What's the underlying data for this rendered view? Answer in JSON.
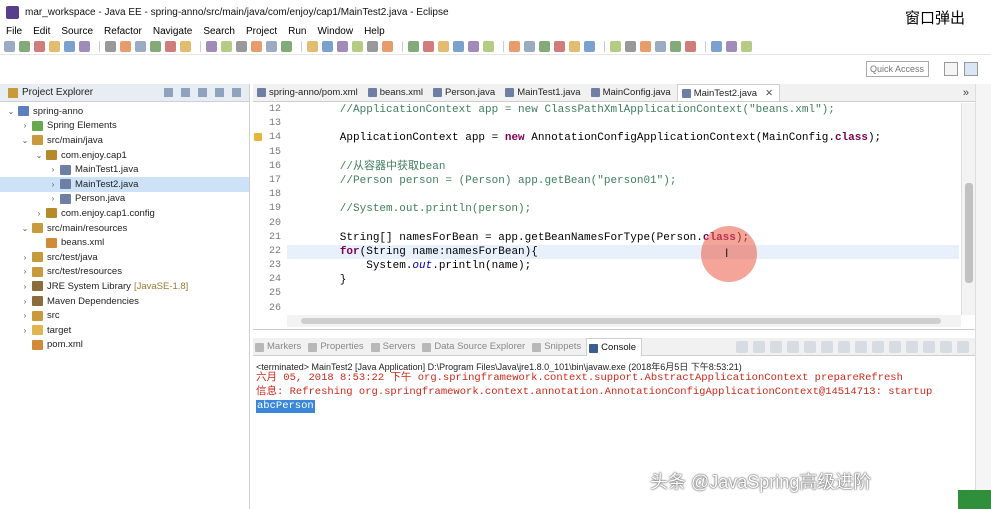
{
  "window": {
    "title": "mar_workspace - Java EE - spring-anno/src/main/java/com/enjoy/cap1/MainTest2.java - Eclipse",
    "popup_label": "窗口弹出"
  },
  "menu": [
    "File",
    "Edit",
    "Source",
    "Refactor",
    "Navigate",
    "Search",
    "Project",
    "Run",
    "Window",
    "Help"
  ],
  "quick_access": {
    "placeholder": "Quick Access"
  },
  "project_explorer": {
    "title": "Project Explorer",
    "nodes": [
      {
        "label": "spring-anno",
        "depth": 0,
        "twisty": "⌄",
        "icon": "project-icon",
        "color": "#5b7fbf"
      },
      {
        "label": "Spring Elements",
        "depth": 1,
        "twisty": "›",
        "icon": "spring-leaf-icon",
        "color": "#6aa84f"
      },
      {
        "label": "src/main/java",
        "depth": 1,
        "twisty": "⌄",
        "icon": "source-folder-icon",
        "color": "#c79a3c"
      },
      {
        "label": "com.enjoy.cap1",
        "depth": 2,
        "twisty": "⌄",
        "icon": "package-icon",
        "color": "#b58a2a"
      },
      {
        "label": "MainTest1.java",
        "depth": 3,
        "twisty": "›",
        "icon": "java-file-icon",
        "color": "#6e7fa3"
      },
      {
        "label": "MainTest2.java",
        "depth": 3,
        "twisty": "›",
        "icon": "java-file-icon",
        "color": "#6e7fa3",
        "selected": true
      },
      {
        "label": "Person.java",
        "depth": 3,
        "twisty": "›",
        "icon": "java-file-icon",
        "color": "#6e7fa3"
      },
      {
        "label": "com.enjoy.cap1.config",
        "depth": 2,
        "twisty": "›",
        "icon": "package-icon",
        "color": "#b58a2a"
      },
      {
        "label": "src/main/resources",
        "depth": 1,
        "twisty": "⌄",
        "icon": "source-folder-icon",
        "color": "#c79a3c"
      },
      {
        "label": "beans.xml",
        "depth": 2,
        "twisty": "",
        "icon": "xml-file-icon",
        "color": "#d08a3a"
      },
      {
        "label": "src/test/java",
        "depth": 1,
        "twisty": "›",
        "icon": "source-folder-icon",
        "color": "#c79a3c"
      },
      {
        "label": "src/test/resources",
        "depth": 1,
        "twisty": "›",
        "icon": "source-folder-icon",
        "color": "#c79a3c"
      },
      {
        "label": "JRE System Library",
        "version": "[JavaSE-1.8]",
        "depth": 1,
        "twisty": "›",
        "icon": "library-icon",
        "color": "#8a6d3b"
      },
      {
        "label": "Maven Dependencies",
        "depth": 1,
        "twisty": "›",
        "icon": "library-icon",
        "color": "#8a6d3b"
      },
      {
        "label": "src",
        "depth": 1,
        "twisty": "›",
        "icon": "folder-icon",
        "color": "#c79a3c"
      },
      {
        "label": "target",
        "depth": 1,
        "twisty": "›",
        "icon": "folder-icon",
        "color": "#e0b450"
      },
      {
        "label": "pom.xml",
        "depth": 1,
        "twisty": "",
        "icon": "xml-file-icon",
        "color": "#d08a3a"
      }
    ]
  },
  "editor": {
    "tabs": [
      {
        "label": "spring-anno/pom.xml",
        "active": false
      },
      {
        "label": "beans.xml",
        "active": false
      },
      {
        "label": "Person.java",
        "active": false
      },
      {
        "label": "MainTest1.java",
        "active": false
      },
      {
        "label": "MainConfig.java",
        "active": false
      },
      {
        "label": "MainTest2.java",
        "active": true,
        "close": "✕"
      }
    ],
    "more_tabs": "»",
    "lines": [
      {
        "n": "12",
        "parts": [
          [
            "cm",
            "        //ApplicationContext app = new ClassPathXmlApplicationContext(\"beans.xml\");"
          ]
        ]
      },
      {
        "n": "13",
        "parts": []
      },
      {
        "n": "14",
        "warn": true,
        "parts": [
          [
            "var",
            "        ApplicationContext "
          ],
          [
            "var",
            "app"
          ],
          [
            "var",
            " = "
          ],
          [
            "kw",
            "new"
          ],
          [
            "var",
            " AnnotationConfigApplicationContext(MainConfig."
          ],
          [
            "kw",
            "class"
          ],
          [
            "var",
            ");"
          ]
        ]
      },
      {
        "n": "15",
        "parts": []
      },
      {
        "n": "16",
        "parts": [
          [
            "cm",
            "        //从容器中获取bean"
          ]
        ]
      },
      {
        "n": "17",
        "parts": [
          [
            "cm",
            "        //Person person = (Person) app.getBean(\"person01\");"
          ]
        ]
      },
      {
        "n": "18",
        "parts": []
      },
      {
        "n": "19",
        "parts": [
          [
            "cm",
            "        //System.out.println(person);"
          ]
        ]
      },
      {
        "n": "20",
        "parts": []
      },
      {
        "n": "21",
        "parts": [
          [
            "var",
            "        String[] namesForBean = app.getBeanNamesForType(Person."
          ],
          [
            "kw",
            "class"
          ],
          [
            "var",
            ");"
          ]
        ]
      },
      {
        "n": "22",
        "current": true,
        "parts": [
          [
            "var",
            "        "
          ],
          [
            "kw",
            "for"
          ],
          [
            "var",
            "(String name:namesForBean){"
          ]
        ]
      },
      {
        "n": "23",
        "parts": [
          [
            "var",
            "            System."
          ],
          [
            "fld",
            "out"
          ],
          [
            "var",
            ".println(name);"
          ]
        ]
      },
      {
        "n": "24",
        "parts": [
          [
            "var",
            "        }"
          ]
        ]
      },
      {
        "n": "25",
        "parts": []
      },
      {
        "n": "26",
        "parts": []
      }
    ]
  },
  "console": {
    "tabs": [
      "Markers",
      "Properties",
      "Servers",
      "Data Source Explorer",
      "Snippets",
      "Console"
    ],
    "active_tab": "Console",
    "terminated": "<terminated> MainTest2 [Java Application] D:\\Program Files\\Java\\jre1.8.0_101\\bin\\javaw.exe (2018年6月5日 下午8:53:21)",
    "err_lines": [
      "六月 05, 2018 8:53:22 下午 org.springframework.context.support.AbstractApplicationContext prepareRefresh",
      "信息: Refreshing org.springframework.context.annotation.AnnotationConfigApplicationContext@14514713: startup"
    ],
    "output": "abcPerson"
  },
  "watermark": "头条 @JavaSpring高级进阶"
}
